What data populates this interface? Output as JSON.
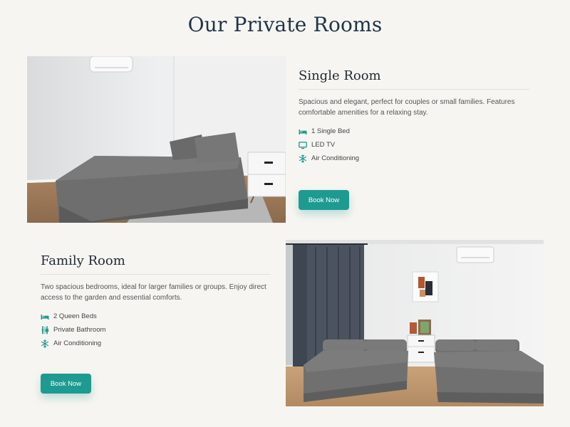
{
  "section": {
    "title": "Our Private Rooms"
  },
  "rooms": [
    {
      "name": "Single Room",
      "description": "Spacious and elegant, perfect for couples or small families. Features comfortable amenities for a relaxing stay.",
      "amenities": [
        {
          "icon": "bed-icon",
          "label": "1 Single Bed"
        },
        {
          "icon": "tv-icon",
          "label": "LED TV"
        },
        {
          "icon": "snowflake-icon",
          "label": "Air Conditioning"
        }
      ],
      "button_label": "Book Now"
    },
    {
      "name": "Family Room",
      "description": "Two spacious bedrooms, ideal for larger families or groups. Enjoy direct access to the garden and essential comforts.",
      "amenities": [
        {
          "icon": "bed-icon",
          "label": "2 Queen Beds"
        },
        {
          "icon": "restroom-icon",
          "label": "Private Bathroom"
        },
        {
          "icon": "snowflake-icon",
          "label": "Air Conditioning"
        }
      ],
      "button_label": "Book Now"
    }
  ],
  "colors": {
    "accent": "#1f9a91",
    "title": "#1f3447",
    "background": "#f7f5f1"
  }
}
